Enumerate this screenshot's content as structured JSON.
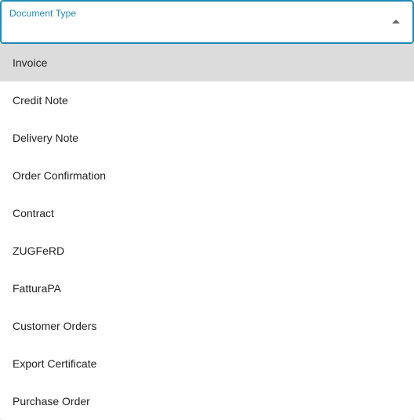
{
  "select": {
    "label": "Document Type",
    "accent_color": "#1f8ab8",
    "caret_icon": "caret-up-icon",
    "highlighted_index": 0
  },
  "options": [
    {
      "label": "Invoice"
    },
    {
      "label": "Credit Note"
    },
    {
      "label": "Delivery Note"
    },
    {
      "label": "Order Confirmation"
    },
    {
      "label": "Contract"
    },
    {
      "label": "ZUGFeRD"
    },
    {
      "label": "FatturaPA"
    },
    {
      "label": "Customer Orders"
    },
    {
      "label": "Export Certificate"
    },
    {
      "label": "Purchase Order"
    }
  ]
}
